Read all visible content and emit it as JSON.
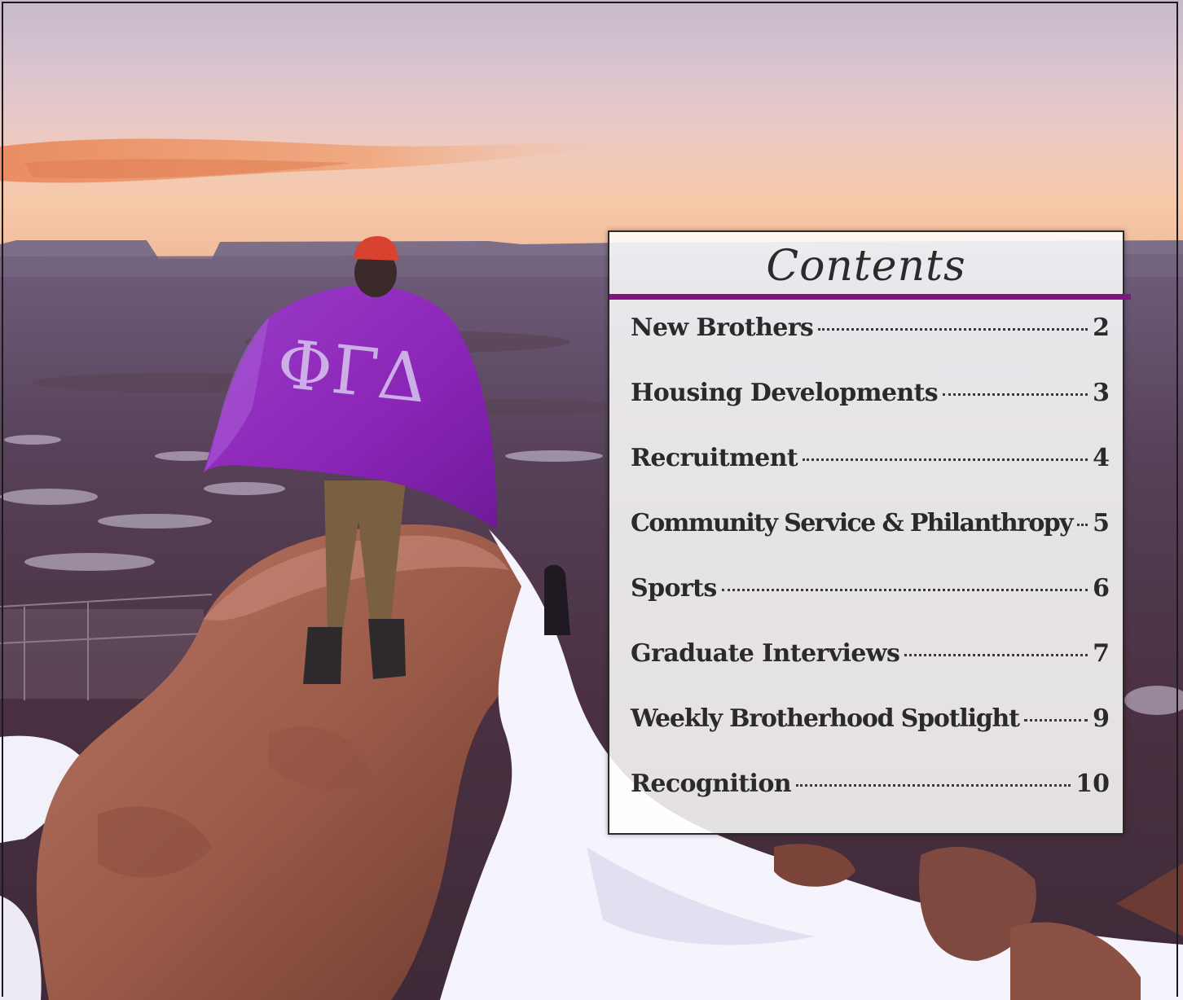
{
  "photo": {
    "icon": "brother-on-mesa-with-flag-photo",
    "flag_letters": "ΦΓΔ",
    "colors": {
      "sky_top": "#c8bccd",
      "sunset_glow": "#f2b48e",
      "cloud": "#e88d5d",
      "canyon": "#4a3240",
      "rock": "#a5614d",
      "snow": "#f4f2fb",
      "flag": "#8a28b8"
    }
  },
  "toc": {
    "title": "Contents",
    "accent_color": "#7f157f",
    "entries": [
      {
        "label": "New Brothers",
        "page": "2"
      },
      {
        "label": "Housing Developments",
        "page": "3"
      },
      {
        "label": "Recruitment",
        "page": "4"
      },
      {
        "label": "Community Service & Philanthropy",
        "page": "5"
      },
      {
        "label": "Sports",
        "page": "6"
      },
      {
        "label": "Graduate Interviews",
        "page": "7"
      },
      {
        "label": "Weekly Brotherhood Spotlight",
        "page": "9"
      },
      {
        "label": "Recognition",
        "page": "10"
      }
    ]
  }
}
